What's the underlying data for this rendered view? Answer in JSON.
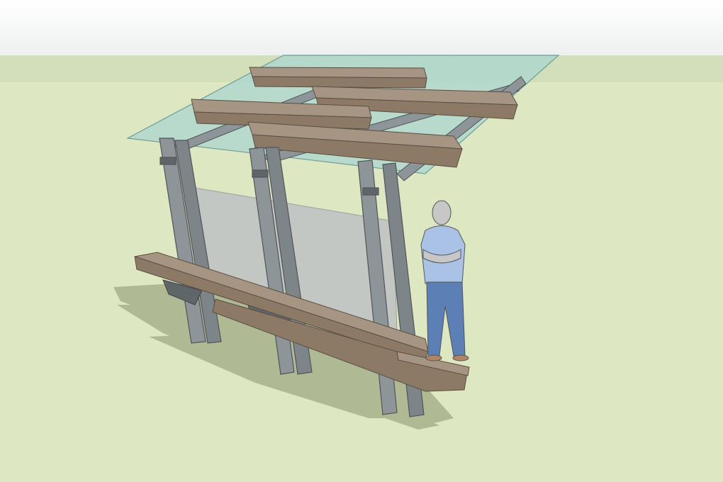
{
  "scene": {
    "sky_color": "#edf0ef",
    "horizon_color": "#d3dfba",
    "ground_color": "#dde8c2",
    "shadow_color": "#a7b28c",
    "glass_color": "#a9d6cf",
    "timber_top_color": "#a69582",
    "timber_side_color": "#8c7a66",
    "steel_color": "#8e9599",
    "steel_dark_color": "#5f666a",
    "backpanel_color": "#c3c7c4",
    "person": {
      "skin_color": "#c7c7c7",
      "shirt_color": "#a9c2e6",
      "jeans_color": "#5c7fb5",
      "shoe_color": "#b08566"
    }
  }
}
